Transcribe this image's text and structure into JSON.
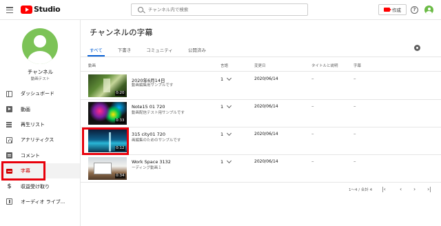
{
  "header": {
    "logo_text": "Studio",
    "search_placeholder": "チャンネル内で検索",
    "create_label": "作成"
  },
  "sidebar": {
    "channel_name": "チャンネル",
    "channel_sub": "動画テスト",
    "items": [
      {
        "label": "ダッシュボード",
        "icon": "dashboard-icon"
      },
      {
        "label": "動画",
        "icon": "video-icon"
      },
      {
        "label": "再生リスト",
        "icon": "playlist-icon"
      },
      {
        "label": "アナリティクス",
        "icon": "analytics-icon"
      },
      {
        "label": "コメント",
        "icon": "comment-icon"
      },
      {
        "label": "字幕",
        "icon": "subtitles-icon",
        "active": true
      },
      {
        "label": "収益受け取り",
        "icon": "monetization-icon"
      },
      {
        "label": "オーディオ ライブ...",
        "icon": "audio-library-icon"
      }
    ]
  },
  "main": {
    "title": "チャンネルの字幕",
    "tabs": [
      "すべて",
      "下書き",
      "コミュニティ",
      "公開済み"
    ],
    "columns": {
      "video": "動画",
      "language": "言語",
      "modified": "変更日",
      "title_desc": "タイトルと説明",
      "subtitles": "字幕"
    },
    "rows": [
      {
        "title": "2020年6月14日",
        "desc": "動画編集用サンプルです",
        "duration": "0:20",
        "lang": "1",
        "date": "2020/06/14",
        "title_desc": "–",
        "subtitles": "–"
      },
      {
        "title": "Note15 01 720",
        "desc": "動画配信テスト用サンプルです",
        "duration": "0:33",
        "lang": "1",
        "date": "2020/06/14",
        "title_desc": "–",
        "subtitles": "–"
      },
      {
        "title": "315 city01 720",
        "desc": "画編集のためのサンプルです",
        "duration": "0:12",
        "lang": "1",
        "date": "2020/06/14",
        "title_desc": "–",
        "subtitles": "–"
      },
      {
        "title": "Work Space 3132",
        "desc": "ーディング動画１",
        "duration": "0:34",
        "lang": "1",
        "date": "2020/06/14",
        "title_desc": "–",
        "subtitles": "–"
      }
    ],
    "pagination": {
      "range": "1〜4 / 合計 4"
    }
  },
  "colors": {
    "accent": "#065fd4",
    "highlight": "#e8000b",
    "brand": "#ff0000"
  }
}
